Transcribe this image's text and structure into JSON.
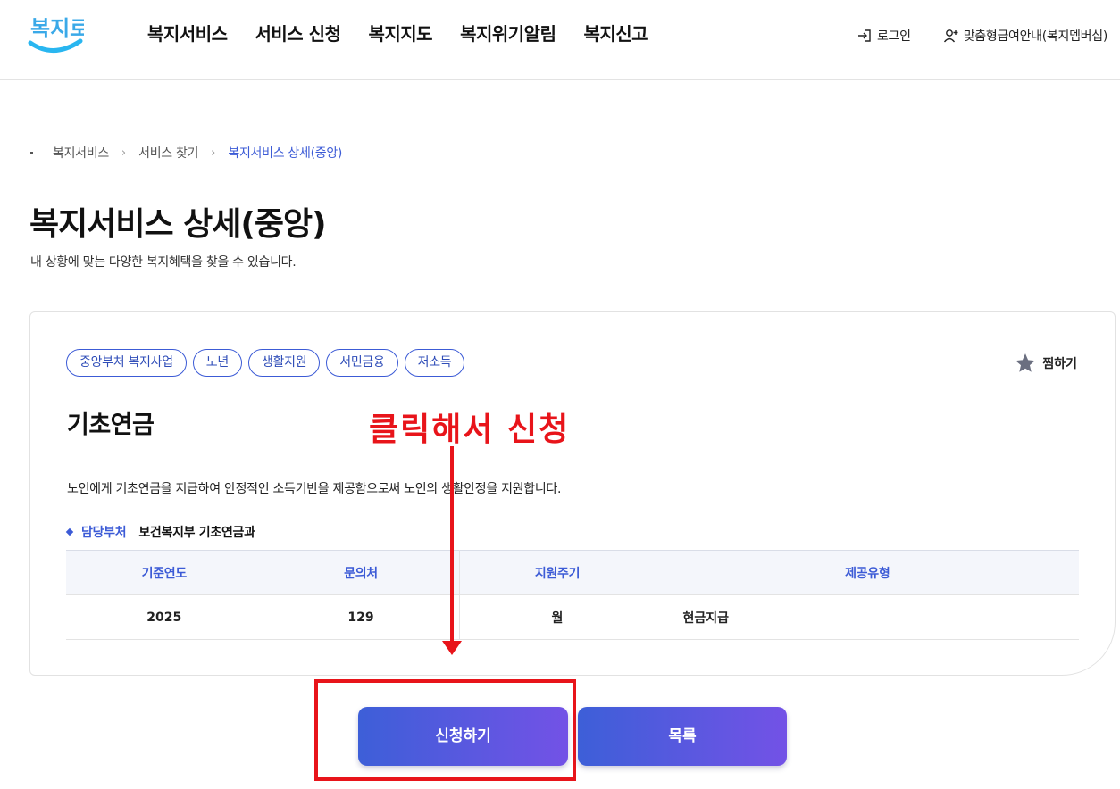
{
  "header": {
    "logo_text": "복지로",
    "nav": [
      "복지서비스",
      "서비스 신청",
      "복지지도",
      "복지위기알림",
      "복지신고"
    ],
    "login": "로그인",
    "guide": "맞춤형급여안내(복지멤버십)"
  },
  "breadcrumb": [
    "복지서비스",
    "서비스 찾기",
    "복지서비스 상세(중앙)"
  ],
  "page": {
    "title": "복지서비스 상세(중앙)",
    "subtitle": "내 상황에 맞는 다양한 복지혜택을 찾을 수 있습니다."
  },
  "card": {
    "tags": [
      "중앙부처 복지사업",
      "노년",
      "생활지원",
      "서민금융",
      "저소득"
    ],
    "bookmark": "찜하기",
    "service_title": "기초연금",
    "description": "노인에게 기초연금을 지급하여 안정적인 소득기반을 제공함으로써 노인의 생활안정을 지원합니다.",
    "dept_label": "담당부처",
    "dept_value": "보건복지부 기초연금과",
    "table": {
      "headers": [
        "기준연도",
        "문의처",
        "지원주기",
        "제공유형"
      ],
      "row": [
        "2025",
        "129",
        "월",
        "현금지급"
      ]
    }
  },
  "annotation": {
    "text": "클릭해서 신청",
    "color": "#e8141a"
  },
  "buttons": {
    "apply": "신청하기",
    "list": "목록"
  },
  "colors": {
    "accent": "#3c5bd6",
    "button_gradient_start": "#3d5fd8",
    "button_gradient_end": "#7352e6"
  }
}
